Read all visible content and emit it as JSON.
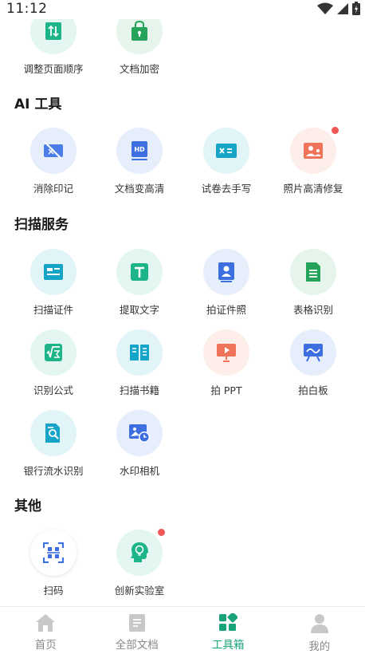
{
  "status": {
    "time": "11:12"
  },
  "partial_row": [
    {
      "label": "调整页面顺序",
      "icon": "reorder-icon"
    },
    {
      "label": "文档加密",
      "icon": "lock-bag-icon"
    }
  ],
  "ai_tools": {
    "title": "AI 工具",
    "items": [
      {
        "label": "消除印记",
        "icon": "remove-mark-icon"
      },
      {
        "label": "文档变高清",
        "icon": "hd-document-icon"
      },
      {
        "label": "试卷去手写",
        "icon": "erase-handwriting-icon"
      },
      {
        "label": "照片高清修复",
        "icon": "photo-restore-icon",
        "badge": true
      }
    ]
  },
  "scan_services": {
    "title": "扫描服务",
    "items": [
      {
        "label": "扫描证件",
        "icon": "id-card-icon"
      },
      {
        "label": "提取文字",
        "icon": "text-extract-icon"
      },
      {
        "label": "拍证件照",
        "icon": "id-photo-icon"
      },
      {
        "label": "表格识别",
        "icon": "sheet-icon"
      },
      {
        "label": "识别公式",
        "icon": "formula-icon"
      },
      {
        "label": "扫描书籍",
        "icon": "book-icon"
      },
      {
        "label": "拍 PPT",
        "icon": "ppt-icon"
      },
      {
        "label": "拍白板",
        "icon": "whiteboard-icon"
      },
      {
        "label": "银行流水识别",
        "icon": "bank-statement-icon"
      },
      {
        "label": "水印相机",
        "icon": "watermark-camera-icon"
      }
    ]
  },
  "others": {
    "title": "其他",
    "items": [
      {
        "label": "扫码",
        "icon": "qr-scan-icon"
      },
      {
        "label": "创新实验室",
        "icon": "innovation-lab-icon",
        "badge": true
      }
    ]
  },
  "tabbar": {
    "tabs": [
      {
        "label": "首页",
        "icon": "home-icon"
      },
      {
        "label": "全部文档",
        "icon": "document-icon"
      },
      {
        "label": "工具箱",
        "icon": "toolbox-icon",
        "active": true
      },
      {
        "label": "我的",
        "icon": "profile-icon"
      }
    ]
  },
  "colors": {
    "accent": "#18a37a",
    "badge": "#f25757"
  }
}
